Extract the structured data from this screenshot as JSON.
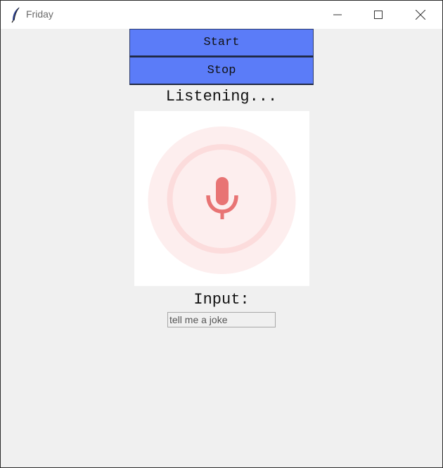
{
  "window": {
    "title": "Friday"
  },
  "controls": {
    "start_label": "Start",
    "stop_label": "Stop"
  },
  "status": {
    "text": "Listening..."
  },
  "mic_visual": {
    "icon": "microphone-icon",
    "accent_color": "#e87474",
    "ring_color": "#fde0e0",
    "halo_color": "#fdeeee"
  },
  "input": {
    "label": "Input:",
    "value": "tell me a joke"
  },
  "colors": {
    "button_bg": "#5b7cf8",
    "window_bg": "#f0f0f0"
  }
}
